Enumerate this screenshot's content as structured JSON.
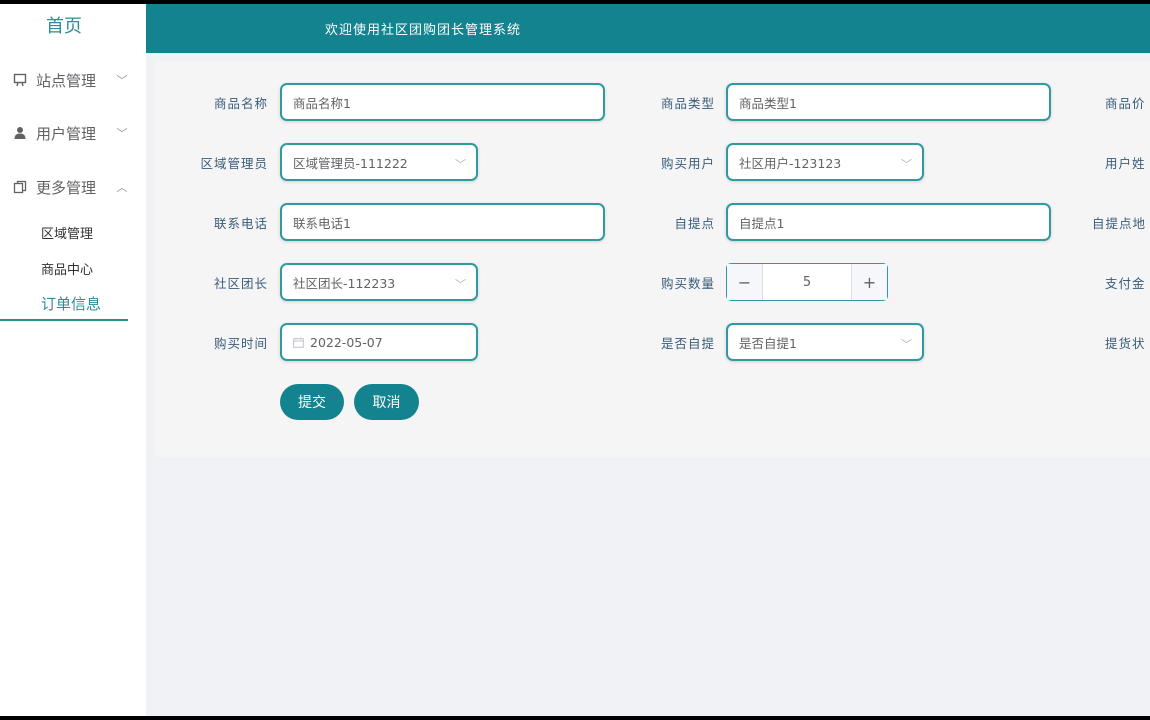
{
  "sidebar": {
    "home": "首页",
    "menus": [
      {
        "label": "站点管理",
        "icon": "monitor-icon",
        "arrow": "﹀"
      },
      {
        "label": "用户管理",
        "icon": "user-icon",
        "arrow": "﹀"
      },
      {
        "label": "更多管理",
        "icon": "copy-icon",
        "arrow": "︿"
      }
    ],
    "subitems": [
      "区域管理",
      "商品中心",
      "订单信息"
    ]
  },
  "header": {
    "title": "欢迎使用社区团购团长管理系统"
  },
  "form": {
    "fields": {
      "product_name": {
        "label": "商品名称",
        "value": "商品名称1"
      },
      "product_type": {
        "label": "商品类型",
        "value": "商品类型1"
      },
      "product_price": {
        "label": "商品价"
      },
      "region_manager": {
        "label": "区域管理员",
        "value": "区域管理员-111222"
      },
      "buyer": {
        "label": "购买用户",
        "value": "社区用户-123123"
      },
      "user_name": {
        "label": "用户姓"
      },
      "phone": {
        "label": "联系电话",
        "value": "联系电话1"
      },
      "pickup_point": {
        "label": "自提点",
        "value": "自提点1"
      },
      "pickup_address": {
        "label": "自提点地"
      },
      "leader": {
        "label": "社区团长",
        "value": "社区团长-112233"
      },
      "quantity": {
        "label": "购买数量",
        "value": "5",
        "minus": "−",
        "plus": "+"
      },
      "pay_amount": {
        "label": "支付金"
      },
      "buy_time": {
        "label": "购买时间",
        "value": "2022-05-07"
      },
      "self_pickup": {
        "label": "是否自提",
        "value": "是否自提1"
      },
      "delivery_status": {
        "label": "提货状"
      }
    },
    "buttons": {
      "submit": "提交",
      "cancel": "取消"
    }
  },
  "colors": {
    "accent": "#12838f",
    "border": "#2f9aa2",
    "label": "#3a5c7a"
  }
}
